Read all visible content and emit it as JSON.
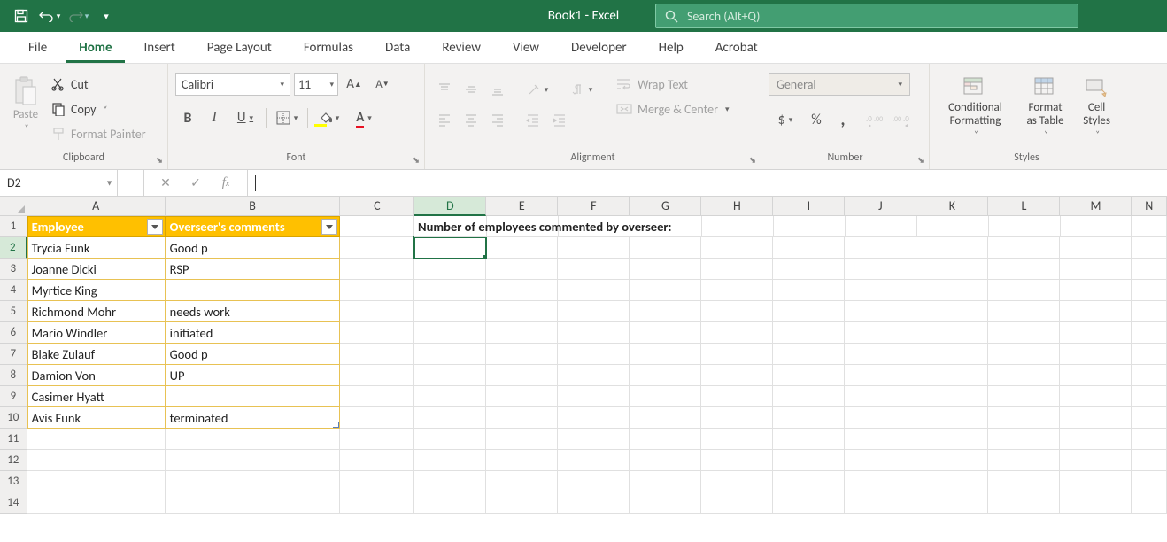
{
  "titlebar": {
    "title": "Book1 - Excel",
    "search_placeholder": "Search (Alt+Q)"
  },
  "tabs": {
    "file": "File",
    "home": "Home",
    "insert": "Insert",
    "pagelayout": "Page Layout",
    "formulas": "Formulas",
    "data": "Data",
    "review": "Review",
    "view": "View",
    "developer": "Developer",
    "help": "Help",
    "acrobat": "Acrobat"
  },
  "ribbon": {
    "clipboard": {
      "paste": "Paste",
      "cut": "Cut",
      "copy": "Copy",
      "fmtpainter": "Format Painter",
      "label": "Clipboard"
    },
    "font": {
      "name": "Calibri",
      "size": "11",
      "label": "Font"
    },
    "alignment": {
      "wrap": "Wrap Text",
      "merge": "Merge & Center",
      "label": "Alignment"
    },
    "number": {
      "format": "General",
      "label": "Number"
    },
    "styles": {
      "cond": "Conditional Formatting",
      "table": "Format as Table",
      "cell": "Cell Styles",
      "label": "Styles"
    }
  },
  "fbar": {
    "namebox": "D2",
    "formula": ""
  },
  "grid": {
    "cols": [
      "A",
      "B",
      "C",
      "D",
      "E",
      "F",
      "G",
      "H",
      "I",
      "J",
      "K",
      "L",
      "M",
      "N"
    ],
    "activeCol": "D",
    "activeRow": 2,
    "header_a": "Employee",
    "header_b": "Overseer's comments",
    "label_d1": "Number of employees commented by overseer:",
    "rows": [
      {
        "a": "Trycia Funk",
        "b": "Good p"
      },
      {
        "a": "Joanne Dicki",
        "b": "RSP"
      },
      {
        "a": "Myrtice King",
        "b": ""
      },
      {
        "a": "Richmond Mohr",
        "b": "needs work"
      },
      {
        "a": "Mario Windler",
        "b": "initiated"
      },
      {
        "a": "Blake Zulauf",
        "b": "Good p"
      },
      {
        "a": "Damion Von",
        "b": "UP"
      },
      {
        "a": "Casimer Hyatt",
        "b": ""
      },
      {
        "a": "Avis Funk",
        "b": "terminated"
      }
    ]
  }
}
